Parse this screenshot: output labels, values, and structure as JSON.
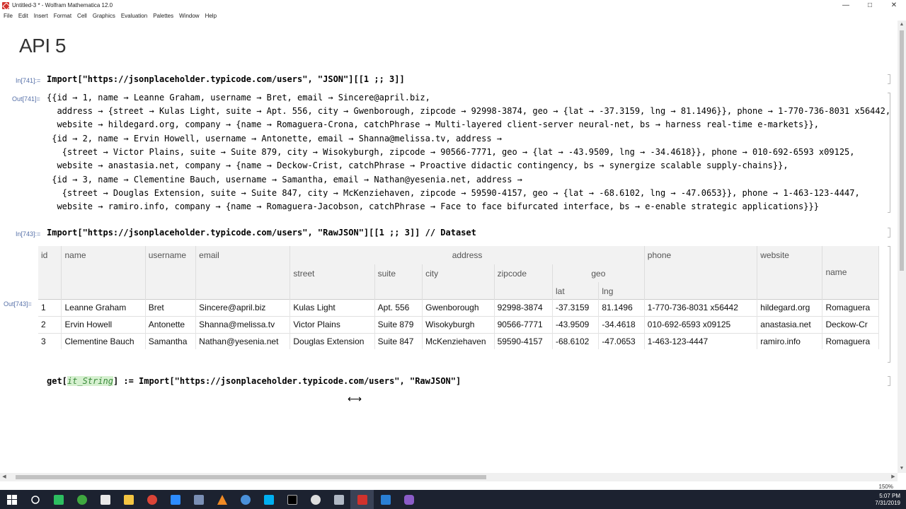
{
  "window": {
    "title": "Untitled-3 * - Wolfram Mathematica 12.0",
    "controls": [
      "—",
      "□",
      "✕"
    ]
  },
  "menu": [
    "File",
    "Edit",
    "Insert",
    "Format",
    "Cell",
    "Graphics",
    "Evaluation",
    "Palettes",
    "Window",
    "Help"
  ],
  "notebook": {
    "title": "API 5",
    "cells": {
      "in741_label": "In[741]:=",
      "in741_code": "Import[\"https://jsonplaceholder.typicode.com/users\", \"JSON\"][[1 ;; 3]]",
      "out741_label": "Out[741]=",
      "out741_lines": [
        "{{id → 1, name → Leanne Graham, username → Bret, email → Sincere@april.biz,",
        "  address → {street → Kulas Light, suite → Apt. 556, city → Gwenborough, zipcode → 92998-3874, geo → {lat → -37.3159, lng → 81.1496}}, phone → 1-770-736-8031 x56442,",
        "  website → hildegard.org, company → {name → Romaguera-Crona, catchPhrase → Multi-layered client-server neural-net, bs → harness real-time e-markets}},",
        " {id → 2, name → Ervin Howell, username → Antonette, email → Shanna@melissa.tv, address →",
        "   {street → Victor Plains, suite → Suite 879, city → Wisokyburgh, zipcode → 90566-7771, geo → {lat → -43.9509, lng → -34.4618}}, phone → 010-692-6593 x09125,",
        "  website → anastasia.net, company → {name → Deckow-Crist, catchPhrase → Proactive didactic contingency, bs → synergize scalable supply-chains}},",
        " {id → 3, name → Clementine Bauch, username → Samantha, email → Nathan@yesenia.net, address →",
        "   {street → Douglas Extension, suite → Suite 847, city → McKenziehaven, zipcode → 59590-4157, geo → {lat → -68.6102, lng → -47.0653}}, phone → 1-463-123-4447,",
        "  website → ramiro.info, company → {name → Romaguera-Jacobson, catchPhrase → Face to face bifurcated interface, bs → e-enable strategic applications}}}"
      ],
      "in743_label": "In[743]:=",
      "in743_code": "Import[\"https://jsonplaceholder.typicode.com/users\", \"RawJSON\"][[1 ;; 3]] // Dataset",
      "out743_label": "Out[743]=",
      "input_pre": "get[",
      "input_arg": "it_String",
      "input_post": "] := Import[\"https://jsonplaceholder.typicode.com/users\", \"RawJSON\"]"
    },
    "dataset": {
      "headers": {
        "id": "id",
        "name": "name",
        "username": "username",
        "email": "email",
        "address": "address",
        "street": "street",
        "suite": "suite",
        "city": "city",
        "zipcode": "zipcode",
        "geo": "geo",
        "lat": "lat",
        "lng": "lng",
        "phone": "phone",
        "website": "website",
        "company_name": "name"
      },
      "rows": [
        [
          "1",
          "Leanne Graham",
          "Bret",
          "Sincere@april.biz",
          "Kulas Light",
          "Apt. 556",
          "Gwenborough",
          "92998-3874",
          "-37.3159",
          "81.1496",
          "1-770-736-8031 x56442",
          "hildegard.org",
          "Romaguera"
        ],
        [
          "2",
          "Ervin Howell",
          "Antonette",
          "Shanna@melissa.tv",
          "Victor Plains",
          "Suite 879",
          "Wisokyburgh",
          "90566-7771",
          "-43.9509",
          "-34.4618",
          "010-692-6593 x09125",
          "anastasia.net",
          "Deckow-Cr"
        ],
        [
          "3",
          "Clementine Bauch",
          "Samantha",
          "Nathan@yesenia.net",
          "Douglas Extension",
          "Suite 847",
          "McKenziehaven",
          "59590-4157",
          "-68.6102",
          "-47.0653",
          "1-463-123-4447",
          "ramiro.info",
          "Romaguera"
        ]
      ]
    },
    "zoom": "150%"
  },
  "taskbar": {
    "icons": [
      "windows-start-icon",
      "cortana-icon",
      "evernote-icon",
      "green-app-icon",
      "slack-icon",
      "file-explorer-icon",
      "chrome-icon",
      "zoom-icon",
      "settings-icon",
      "vlc-icon",
      "terminal-icon",
      "skype-icon",
      "cmd-icon",
      "obs-icon",
      "folder-icon",
      "mathematica-icon",
      "vscode-icon",
      "purple-app-icon"
    ],
    "time": "5:07 PM",
    "date": "7/31/2019"
  }
}
